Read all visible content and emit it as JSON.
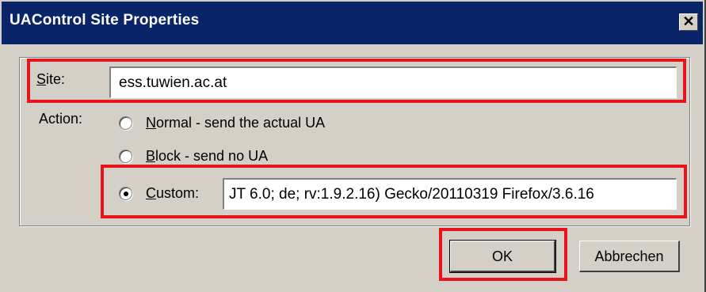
{
  "window": {
    "title": "UAControl Site Properties",
    "close_glyph": "✕"
  },
  "site": {
    "label_accesskey": "S",
    "label_rest": "ite:",
    "value": "ess.tuwien.ac.at"
  },
  "action": {
    "label": "Action:",
    "options": [
      {
        "accesskey": "N",
        "rest": "ormal - send the actual UA",
        "checked": false
      },
      {
        "accesskey": "B",
        "rest": "lock - send no UA",
        "checked": false
      },
      {
        "accesskey": "C",
        "rest": "ustom:",
        "checked": true
      }
    ],
    "custom_value": "JT 6.0; de; rv:1.9.2.16) Gecko/20110319 Firefox/3.6.16"
  },
  "buttons": {
    "ok": "OK",
    "cancel": "Abbrechen"
  },
  "colors": {
    "titlebar": "#0a246a",
    "dialog_bg": "#d4d0c8",
    "highlight": "#e8141c"
  }
}
